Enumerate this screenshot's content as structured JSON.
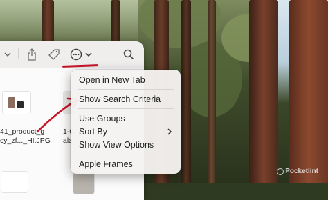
{
  "menu": {
    "items": [
      {
        "label": "Open in New Tab"
      },
      {
        "label": "Show Search Criteria"
      },
      {
        "label": "Use Groups"
      },
      {
        "label": "Sort By"
      },
      {
        "label": "Show View Options"
      },
      {
        "label": "Apple Frames"
      }
    ]
  },
  "files": [
    {
      "line1": "41_product_g",
      "line2": "cy_zf..._HI.JPG"
    },
    {
      "line1": "1-0",
      "line2": "ala"
    }
  ],
  "toolbar": {
    "icons": [
      "chevron-down-icon",
      "share-icon",
      "tag-icon",
      "more-options-icon",
      "search-icon"
    ]
  },
  "watermark": {
    "text": "Pocketlint"
  },
  "colors": {
    "annotation": "#c8142a"
  }
}
